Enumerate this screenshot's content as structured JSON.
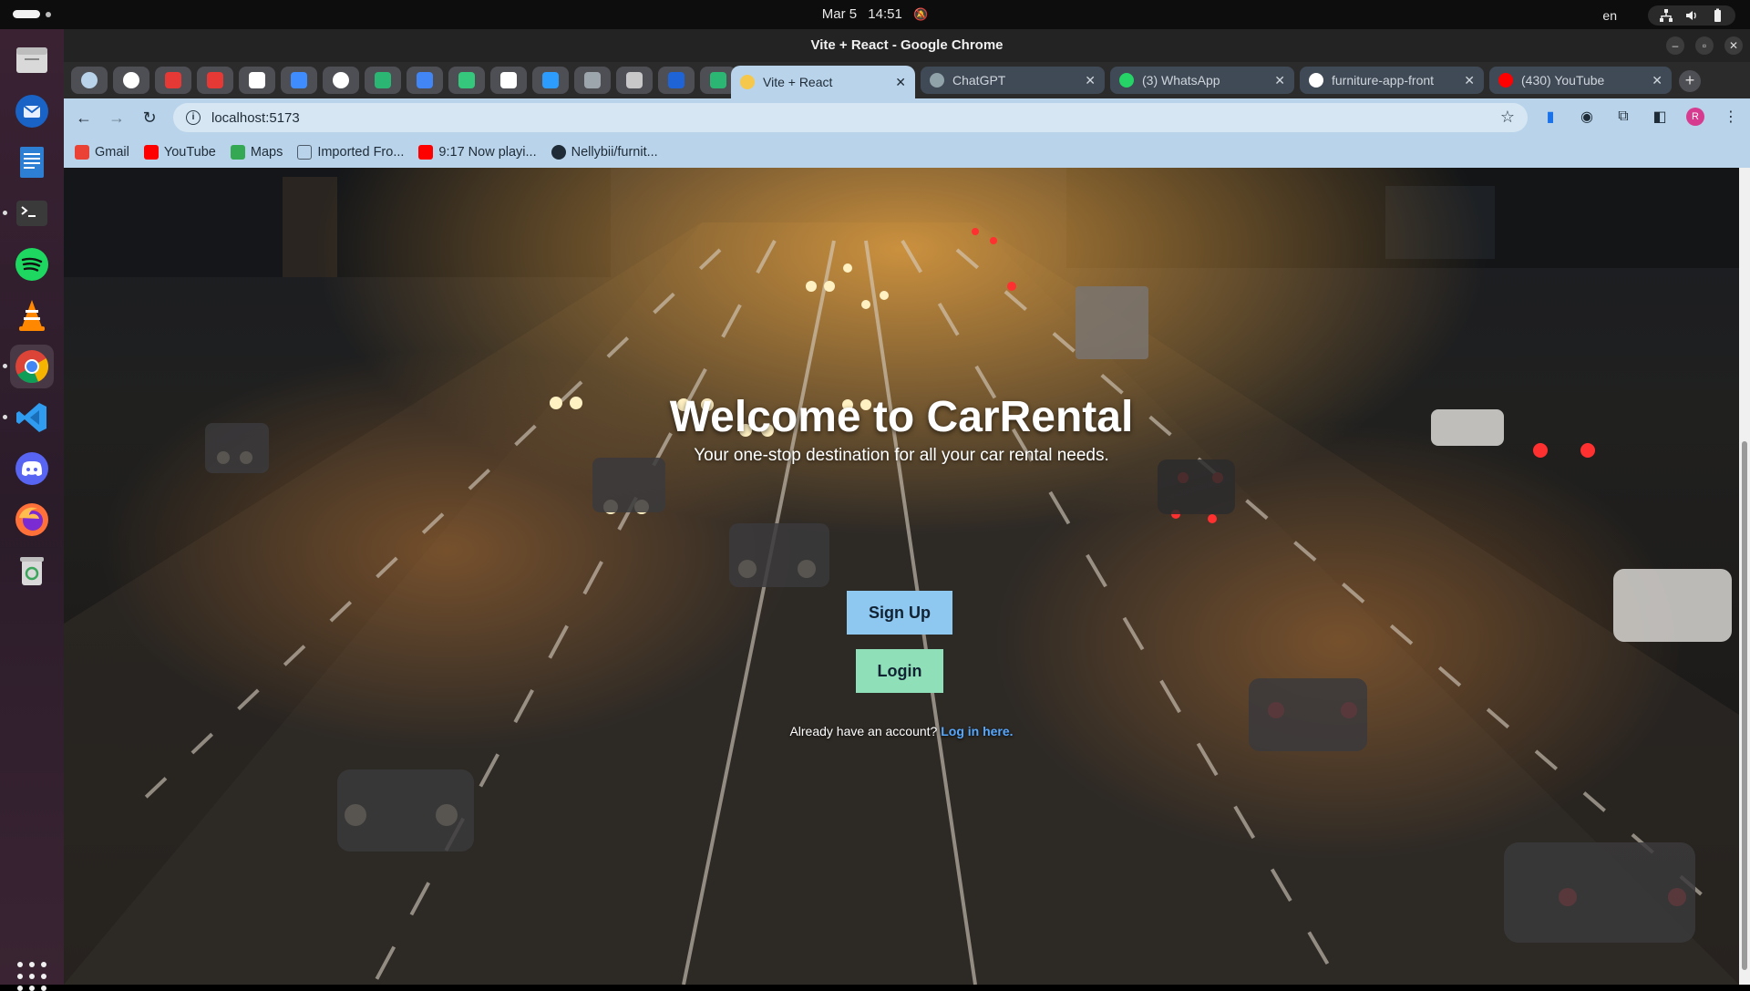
{
  "system": {
    "date": "Mar 5",
    "time": "14:51",
    "lang": "en"
  },
  "window": {
    "title": "Vite + React - Google Chrome"
  },
  "tabs": [
    {
      "title": "Vite + React",
      "favicon_color": "#f5c84c",
      "active": true
    },
    {
      "title": "ChatGPT",
      "favicon_color": "#8fa3a8",
      "active": false
    },
    {
      "title": "(3) WhatsApp",
      "favicon_color": "#25d366",
      "active": false
    },
    {
      "title": "furniture-app-front",
      "favicon_color": "#ffffff",
      "active": false
    },
    {
      "title": "(430) YouTube",
      "favicon_color": "#ff0000",
      "active": false
    }
  ],
  "pinned_tabs": [
    {
      "icon": "chevron-down-icon",
      "color": "#b9d4ea"
    },
    {
      "icon": "github-icon",
      "color": "#ffffff"
    },
    {
      "icon": "record-icon",
      "color": "#e53935"
    },
    {
      "icon": "calendar-badge-icon",
      "color": "#e53935"
    },
    {
      "icon": "triangle-app-icon",
      "color": "#ffffff"
    },
    {
      "icon": "share-icon",
      "color": "#3f8cff"
    },
    {
      "icon": "github-icon",
      "color": "#ffffff"
    },
    {
      "icon": "sheets-icon",
      "color": "#2bb673"
    },
    {
      "icon": "docs-icon",
      "color": "#4285f4"
    },
    {
      "icon": "map-pin-icon",
      "color": "#35c77b"
    },
    {
      "icon": "t-app-icon",
      "color": "#ffffff"
    },
    {
      "icon": "k-app-icon",
      "color": "#2c9cff"
    },
    {
      "icon": "d-app-icon",
      "color": "#9ea6ad"
    },
    {
      "icon": "gear-icon",
      "color": "#c8c8c8"
    },
    {
      "icon": "paypal-icon",
      "color": "#1e64d6"
    },
    {
      "icon": "w-app-icon",
      "color": "#2bb673"
    }
  ],
  "address_bar": {
    "url": "localhost:5173"
  },
  "bookmarks": [
    {
      "label": "Gmail",
      "color": "#ea4335"
    },
    {
      "label": "YouTube",
      "color": "#ff0000"
    },
    {
      "label": "Maps",
      "color": "#34a853"
    },
    {
      "label": "Imported Fro...",
      "color": "#4d5b68"
    },
    {
      "label": "9:17 Now playi...",
      "color": "#ff0000"
    },
    {
      "label": "Nellybii/furnit...",
      "color": "#1f2c38"
    }
  ],
  "hero": {
    "title": "Welcome to CarRental",
    "subtitle": "Your one-stop destination for all your car rental needs.",
    "signup_label": "Sign Up",
    "login_label": "Login",
    "already_text": "Already have an account?",
    "login_link": "Log in here."
  },
  "dock": [
    {
      "name": "files-icon",
      "color": "#e0e0e0"
    },
    {
      "name": "thunderbird-icon",
      "color": "#3a8fe0"
    },
    {
      "name": "writer-icon",
      "color": "#2d7fd3"
    },
    {
      "name": "terminal-icon",
      "color": "#3a3a3a"
    },
    {
      "name": "spotify-icon",
      "color": "#1ed760"
    },
    {
      "name": "vlc-icon",
      "color": "#ff8800"
    },
    {
      "name": "chrome-icon",
      "color": "#4285f4"
    },
    {
      "name": "vscode-icon",
      "color": "#2f9cf0"
    },
    {
      "name": "discord-icon",
      "color": "#5865f2"
    },
    {
      "name": "firefox-icon",
      "color": "#ff7139"
    },
    {
      "name": "trash-icon",
      "color": "#9bd3a8"
    }
  ]
}
